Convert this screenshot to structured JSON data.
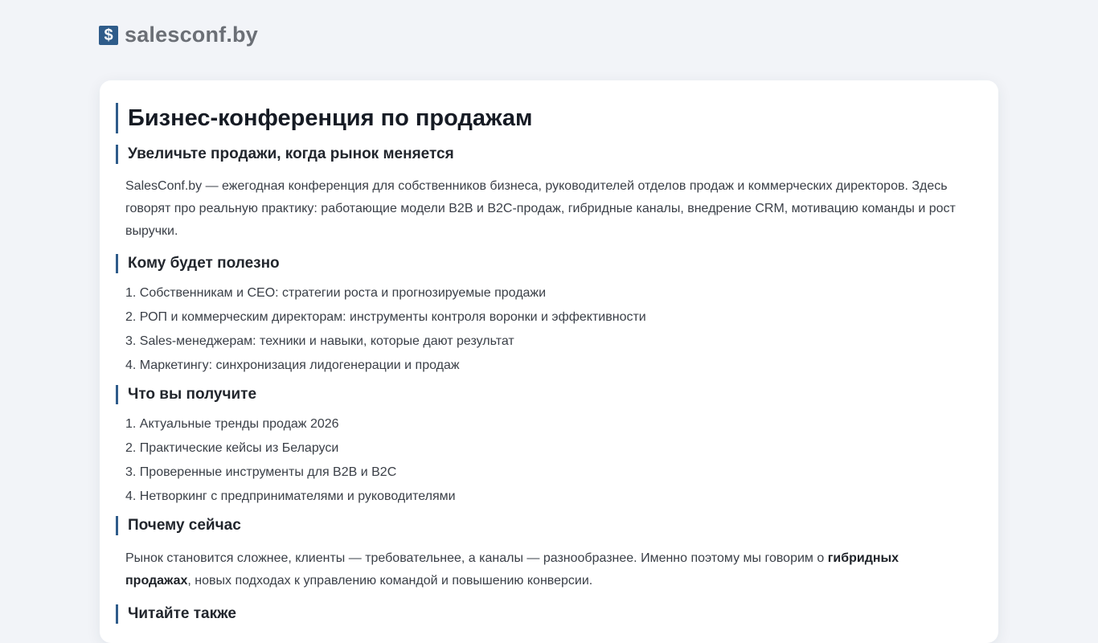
{
  "site": {
    "logo_glyph": "$",
    "name": "salesconf.by"
  },
  "article": {
    "title": "Бизнес-конференция по продажам",
    "sections": [
      {
        "heading": "Увеличьте продажи, когда рынок меняется",
        "paragraph": "SalesConf.by — ежегодная конференция для собственников бизнеса, руководителей отделов продаж и коммерческих директоров. Здесь говорят про реальную практику: работающие модели B2B и B2C-продаж, гибридные каналы, внедрение CRM, мотивацию команды и рост выручки."
      },
      {
        "heading": "Кому будет полезно",
        "items": [
          "1. Собственникам и CEO: стратегии роста и прогнозируемые продажи",
          "2. РОП и коммерческим директорам: инструменты контроля воронки и эффективности",
          "3. Sales-менеджерам: техники и навыки, которые дают результат",
          "4. Маркетингу: синхронизация лидогенерации и продаж"
        ]
      },
      {
        "heading": "Что вы получите",
        "items": [
          "1. Актуальные тренды продаж 2026",
          "2. Практические кейсы из Беларуси",
          "3. Проверенные инструменты для B2B и B2C",
          "4. Нетворкинг с предпринимателями и руководителями"
        ]
      },
      {
        "heading": "Почему сейчас",
        "paragraph_before": "Рынок становится сложнее, клиенты — требовательнее, а каналы — разнообразнее. Именно поэтому мы говорим о ",
        "paragraph_strong": "гибридных продажах",
        "paragraph_after": ", новых подходах к управлению командой и повышению конверсии."
      },
      {
        "heading": "Читайте также"
      }
    ]
  },
  "colors": {
    "accent": "#2f5c8a",
    "background": "#f2f4f8",
    "card": "#ffffff"
  }
}
